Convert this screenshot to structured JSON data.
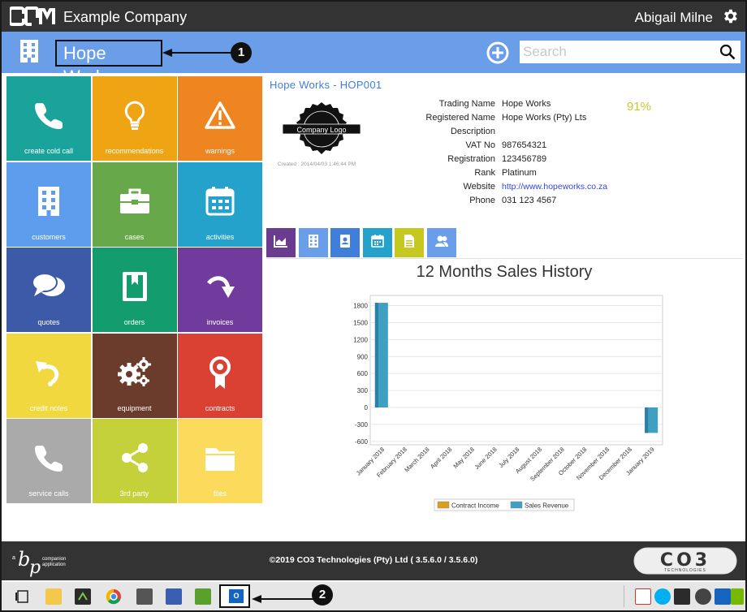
{
  "topbar": {
    "company": "Example Company",
    "user": "Abigail Milne"
  },
  "subbar": {
    "account_name": "Hope Works",
    "callout_1": "1",
    "search_placeholder": "Search"
  },
  "tiles": [
    {
      "label": "create cold call",
      "color": "#1aa39a",
      "icon": "phone-icon"
    },
    {
      "label": "recommendations",
      "color": "#efa414",
      "icon": "lightbulb-icon"
    },
    {
      "label": "warnings",
      "color": "#ee8521",
      "icon": "warning-icon"
    },
    {
      "label": "customers",
      "color": "#5e9ded",
      "icon": "building-icon"
    },
    {
      "label": "cases",
      "color": "#66a84a",
      "icon": "briefcase-icon"
    },
    {
      "label": "activities",
      "color": "#24a2cb",
      "icon": "calendar-icon"
    },
    {
      "label": "quotes",
      "color": "#3d5aa8",
      "icon": "chat-icon"
    },
    {
      "label": "orders",
      "color": "#139d6e",
      "icon": "book-icon"
    },
    {
      "label": "invoices",
      "color": "#713b9d",
      "icon": "redo-arrow-icon"
    },
    {
      "label": "credit notes",
      "color": "#f1d83e",
      "icon": "undo-arrow-icon"
    },
    {
      "label": "equipment",
      "color": "#6b3b2c",
      "icon": "gears-icon"
    },
    {
      "label": "contracts",
      "color": "#da4133",
      "icon": "award-icon"
    },
    {
      "label": "service calls",
      "color": "#aaaaaa",
      "icon": "phone-icon"
    },
    {
      "label": "3rd party",
      "color": "#c5d13b",
      "icon": "share-icon"
    },
    {
      "label": "files",
      "color": "#fbda5c",
      "icon": "folder-icon"
    }
  ],
  "account": {
    "heading": "Hope Works - HOP001",
    "logo_text": "Company Logo",
    "created": "Created : 2014/04/03 1:46:44 PM",
    "completeness": "91%",
    "fields": [
      {
        "key": "Trading Name",
        "value": "Hope Works"
      },
      {
        "key": "Registered Name",
        "value": "Hope Works (Pty) Lts"
      },
      {
        "key": "Description",
        "value": ""
      },
      {
        "key": "VAT No",
        "value": "987654321"
      },
      {
        "key": "Registration",
        "value": "123456789"
      },
      {
        "key": "Rank",
        "value": "Platinum"
      },
      {
        "key": "Website",
        "value": "http://www.hopeworks.co.za"
      },
      {
        "key": "Phone",
        "value": "031 123 4567"
      }
    ]
  },
  "tabs": [
    {
      "icon": "area-chart-icon",
      "color": "#6b3b8f"
    },
    {
      "icon": "building-icon",
      "color": "#6a9ee8"
    },
    {
      "icon": "contacts-book-icon",
      "color": "#3f7fd9"
    },
    {
      "icon": "calendar-icon",
      "color": "#24a2cb"
    },
    {
      "icon": "document-icon",
      "color": "#c5c81f"
    },
    {
      "icon": "users-icon",
      "color": "#6a9ee8"
    }
  ],
  "chart_data": {
    "type": "bar",
    "title": "12 Months Sales History",
    "categories": [
      "January 2018",
      "February 2018",
      "March 2018",
      "April 2018",
      "May 2018",
      "June 2018",
      "July 2018",
      "August 2018",
      "September 2018",
      "October 2018",
      "November 2018",
      "December 2018",
      "January 2019"
    ],
    "series": [
      {
        "name": "Contract Income",
        "color": "#d9a01c",
        "values": [
          0,
          0,
          0,
          0,
          0,
          0,
          0,
          0,
          0,
          0,
          0,
          0,
          0
        ]
      },
      {
        "name": "Sales Revenue",
        "color": "#3fa0c4",
        "values": [
          1850,
          0,
          0,
          0,
          0,
          0,
          0,
          0,
          0,
          0,
          0,
          0,
          -450
        ]
      }
    ],
    "ylim": [
      -660,
      1980
    ],
    "yticks": [
      1800,
      1500,
      1200,
      900,
      600,
      300,
      0,
      -300,
      -600
    ],
    "grid": true,
    "legend": "bottom"
  },
  "footer": {
    "copyright": "©2019 CO3 Technologies (Pty) Ltd ( 3.5.6.0 / 3.5.6.0)",
    "left_logo_small": "a",
    "left_logo_tag1": "companion",
    "left_logo_tag2": "application",
    "right_logo_sub": "TECHNOLOGIES"
  },
  "taskbar": {
    "outlook_label": "O",
    "callout_2": "2"
  }
}
